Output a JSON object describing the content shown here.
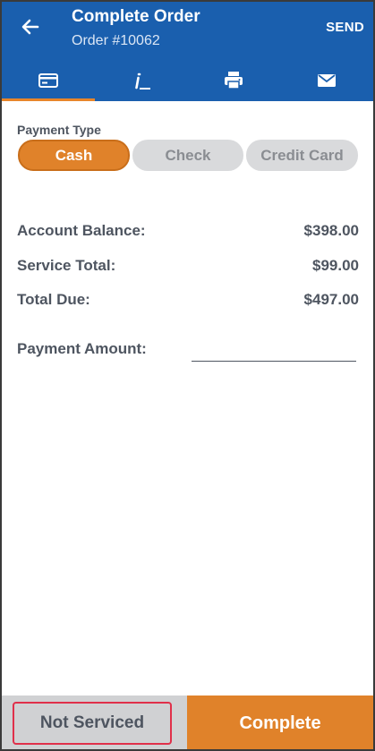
{
  "header": {
    "title": "Complete Order",
    "subtitle": "Order #10062",
    "send_label": "SEND"
  },
  "tabs": [
    {
      "icon": "payment-card-icon",
      "active": true
    },
    {
      "icon": "signature-icon",
      "active": false
    },
    {
      "icon": "printer-icon",
      "active": false
    },
    {
      "icon": "envelope-icon",
      "active": false
    }
  ],
  "payment": {
    "type_label": "Payment Type",
    "options": [
      "Cash",
      "Check",
      "Credit Card"
    ],
    "selected": "Cash"
  },
  "summary": {
    "account_balance_label": "Account Balance:",
    "account_balance_value": "$398.00",
    "service_total_label": "Service Total:",
    "service_total_value": "$99.00",
    "total_due_label": "Total Due:",
    "total_due_value": "$497.00"
  },
  "payment_amount": {
    "label": "Payment Amount:",
    "value": "",
    "placeholder": ""
  },
  "footer": {
    "not_serviced_label": "Not Serviced",
    "complete_label": "Complete"
  },
  "colors": {
    "appbar": "#1a5fae",
    "accent": "#e0822a",
    "highlight_border": "#e0304a"
  }
}
